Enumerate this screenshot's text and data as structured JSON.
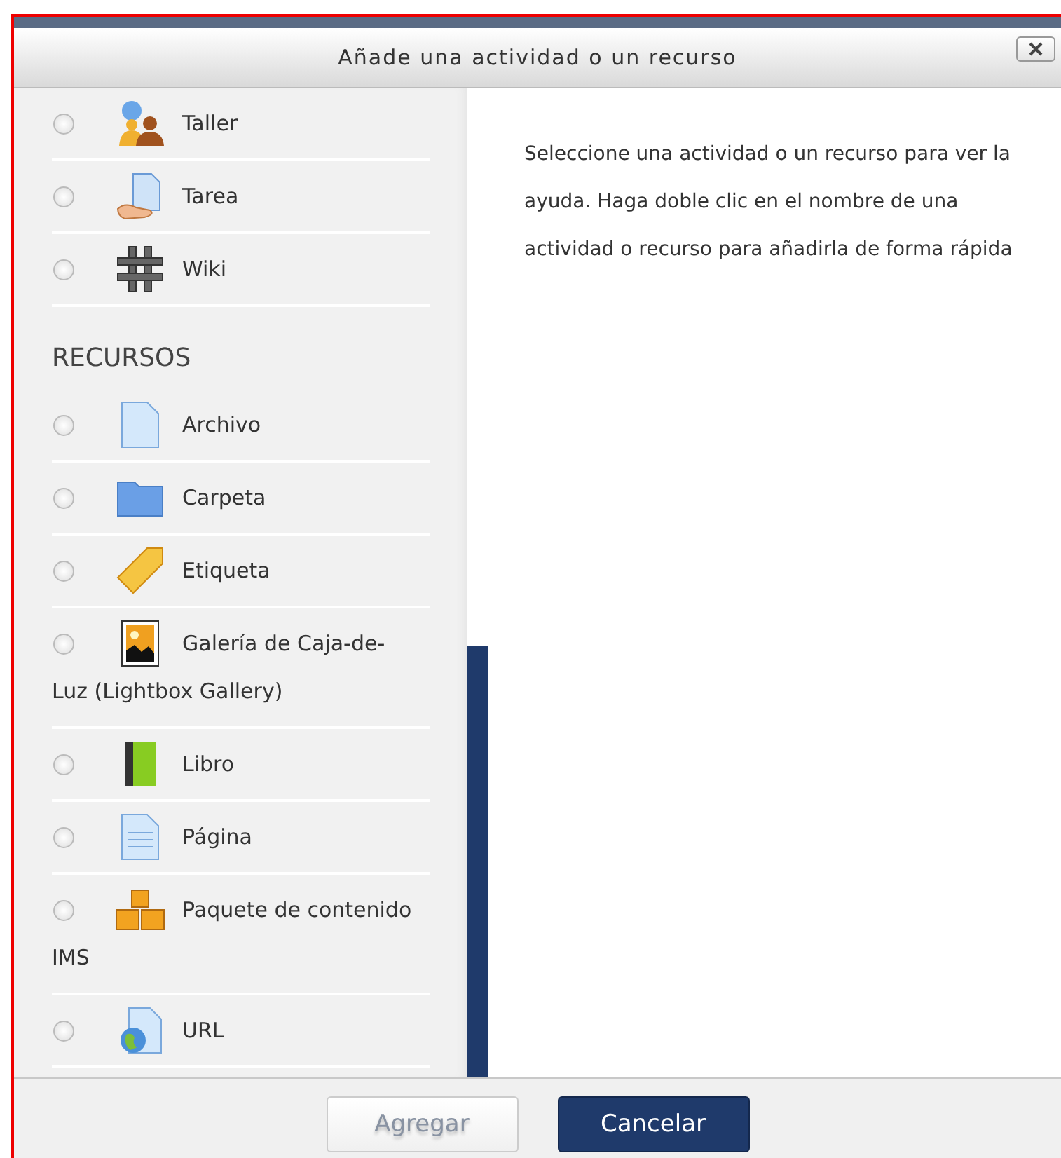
{
  "dialog": {
    "title": "Añade una actividad o un recurso"
  },
  "sections": [
    {
      "items": [
        {
          "label": "Taller",
          "kind": "workshop",
          "selected": false
        },
        {
          "label": "Tarea",
          "kind": "assignment",
          "selected": false
        },
        {
          "label": "Wiki",
          "kind": "wiki",
          "selected": false
        }
      ]
    },
    {
      "heading": "RECURSOS",
      "items": [
        {
          "label": "Archivo",
          "kind": "file",
          "selected": false
        },
        {
          "label": "Carpeta",
          "kind": "folder",
          "selected": false
        },
        {
          "label": "Etiqueta",
          "kind": "tag",
          "selected": false
        },
        {
          "label": "Galería de Caja-de-Luz (Lightbox Gallery)",
          "kind": "gallery",
          "selected": false
        },
        {
          "label": "Libro",
          "kind": "book",
          "selected": false
        },
        {
          "label": "Página",
          "kind": "page",
          "selected": false
        },
        {
          "label": "Paquete de contenido IMS",
          "kind": "package",
          "selected": false
        },
        {
          "label": "URL",
          "kind": "url",
          "selected": false
        }
      ]
    }
  ],
  "help_text": "Seleccione una actividad o un recurso para ver la ayuda. Haga doble clic en el nombre de una actividad o recurso para añadirla de forma rápida",
  "buttons": [
    {
      "label": "Agregar",
      "kind": "secondary",
      "disabled": true
    },
    {
      "label": "Cancelar",
      "kind": "primary",
      "disabled": false
    }
  ]
}
